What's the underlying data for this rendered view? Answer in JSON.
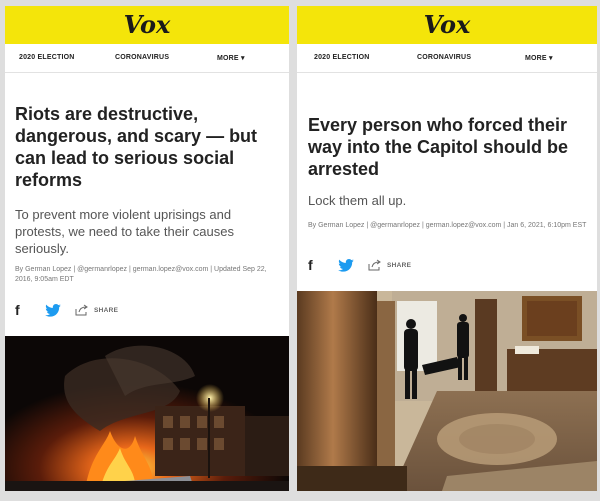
{
  "left_article": {
    "brand": "Vox",
    "nav": {
      "item1": "2020 ELECTION",
      "item2": "CORONAVIRUS",
      "item3": "MORE"
    },
    "headline": "Riots are destructive, dangerous, and scary — but can lead to serious social reforms",
    "dek": "To prevent more violent uprisings and protests, we need to take their causes seriously.",
    "byline": "By German Lopez | @germanrlopez | german.lopez@vox.com | Updated Sep 22, 2016, 9:05am EDT",
    "share_label": "SHARE"
  },
  "right_article": {
    "brand": "Vox",
    "nav": {
      "item1": "2020 ELECTION",
      "item2": "CORONAVIRUS",
      "item3": "MORE"
    },
    "headline": "Every person who forced their way into the Capitol should be arrested",
    "dek": "Lock them all up.",
    "byline": "By German Lopez | @germanrlopez | german.lopez@vox.com | Jan 6, 2021, 6:10pm EST",
    "share_label": "SHARE"
  },
  "icons": {
    "facebook": "facebook-icon",
    "twitter": "twitter-icon",
    "share": "share-arrow-icon",
    "menu_caret": "chevron-down-icon"
  },
  "colors": {
    "header_yellow": "#f4e50a",
    "twitter_blue": "#1d9bf0",
    "headline": "#222222",
    "page_bg": "#dedede"
  }
}
